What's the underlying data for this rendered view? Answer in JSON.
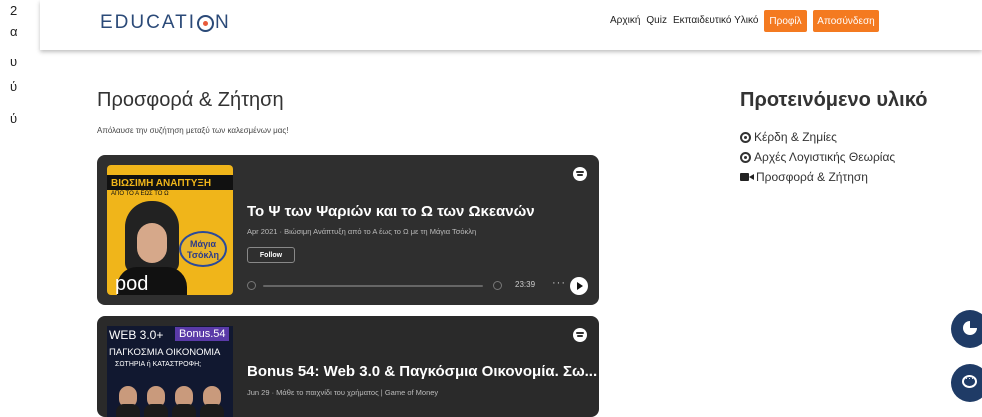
{
  "stray_glyphs": [
    "2",
    "α",
    "υ",
    "ύ",
    "ύ"
  ],
  "header": {
    "logo_left": "EDUCATI",
    "logo_right": "N",
    "nav": [
      "Αρχική",
      "Quiz",
      "Εκπαιδευτικό Υλικό"
    ],
    "profile_label": "Προφίλ",
    "logout_label": "Αποσύνδεση",
    "accent_color": "#f47a20",
    "brand_color": "#2b4a78"
  },
  "main": {
    "title": "Προσφορά & Ζήτηση",
    "subtitle": "Απόλαυσε την συζήτηση μεταξύ των καλεσμένων μας!"
  },
  "sidebar": {
    "title": "Προτεινόμενο υλικό",
    "items": [
      {
        "icon": "podcast-icon",
        "label": "Κέρδη & Ζημίες"
      },
      {
        "icon": "podcast-icon",
        "label": "Αρχές Λογιστικής Θεωρίας"
      },
      {
        "icon": "video-icon",
        "label": "Προσφορά & Ζήτηση"
      }
    ]
  },
  "episodes": [
    {
      "art_heading": "ΒΙΩΣΙΜΗ ΑΝΑΠΤΥΞΗ",
      "art_subheading": "ΑΠΟ ΤΟ Α ΕΩΣ ΤΟ Ω",
      "art_guest": "Μάγια Τσόκλη",
      "art_brand": "pod",
      "title": "Το Ψ των Ψαριών και το Ω των Ωκεανών",
      "meta": "Apr 2021 · Βιώσιμη Ανάπτυξη από το Α έως το Ω με τη Μάγια Τσόκλη",
      "follow_label": "Follow",
      "duration": "23:39"
    },
    {
      "art_line1": "WEB 3.0+",
      "art_bonus": "Bonus.54",
      "art_line2": "ΠΑΓΚΟΣΜΙΑ ΟΙΚΟΝΟΜΙΑ",
      "art_line3": "ΣΩΤΗΡΙΑ ή ΚΑΤΑΣΤΡΟΦΗ;",
      "title": "Bonus 54: Web 3.0 & Παγκόσμια Οικονομία. Σω...",
      "meta": "Jun 29 · Μάθε το παιχνίδι του χρήματος | Game of Money"
    }
  ]
}
